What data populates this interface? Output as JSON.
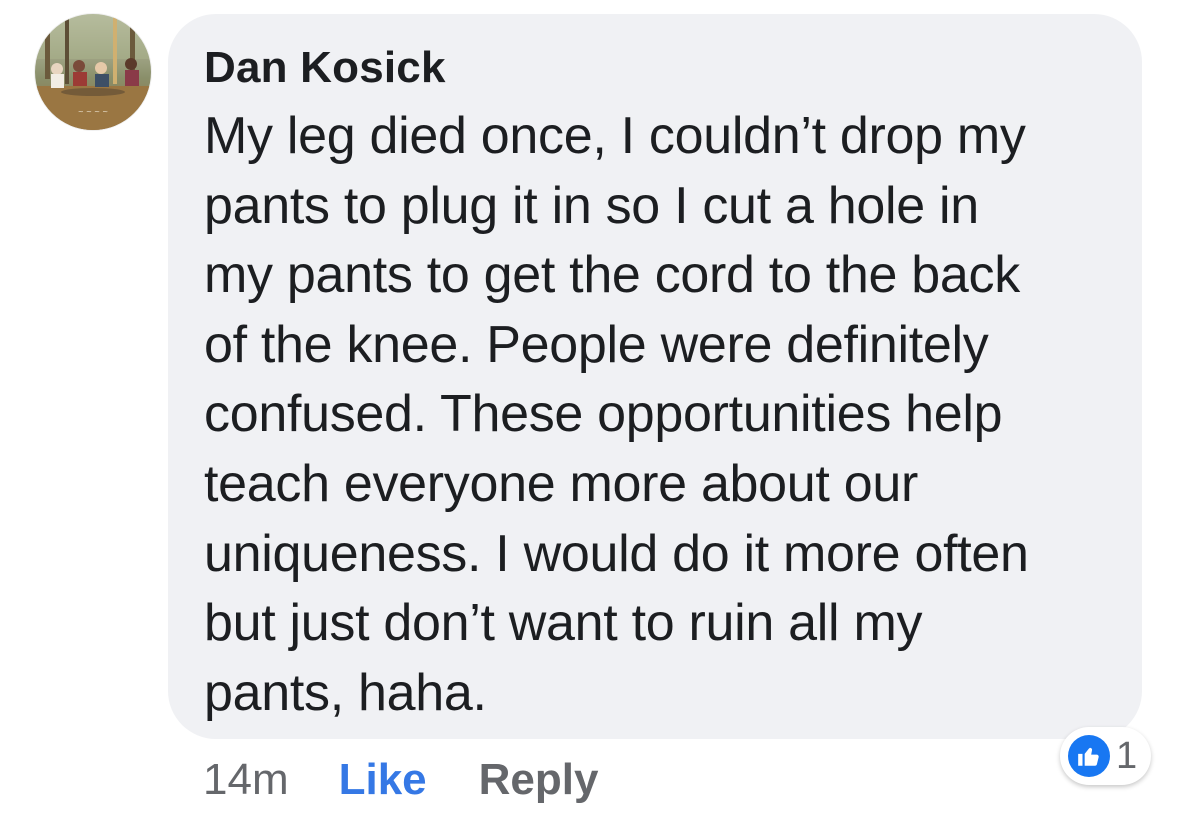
{
  "comment": {
    "author": "Dan Kosick",
    "text_lines": [
      "My leg died once, I couldn’t drop my",
      "pants to plug it in so I cut a hole in",
      "my pants to get the cord to the back",
      "of the knee. People were definitely",
      "confused. These opportunities help",
      "teach everyone more about our",
      "uniqueness. I would do it more often",
      "but just don’t want to ruin all my",
      "pants, haha."
    ],
    "timestamp": "14m",
    "like_label": "Like",
    "reply_label": "Reply",
    "reaction_count": "1",
    "reaction_icon": "thumbs-up-icon"
  },
  "colors": {
    "bubble_background": "#f0f1f4",
    "like_blue": "#3578e5",
    "meta_gray": "#65676b",
    "text": "#1c1e21",
    "reaction_badge": "#1877f2"
  }
}
